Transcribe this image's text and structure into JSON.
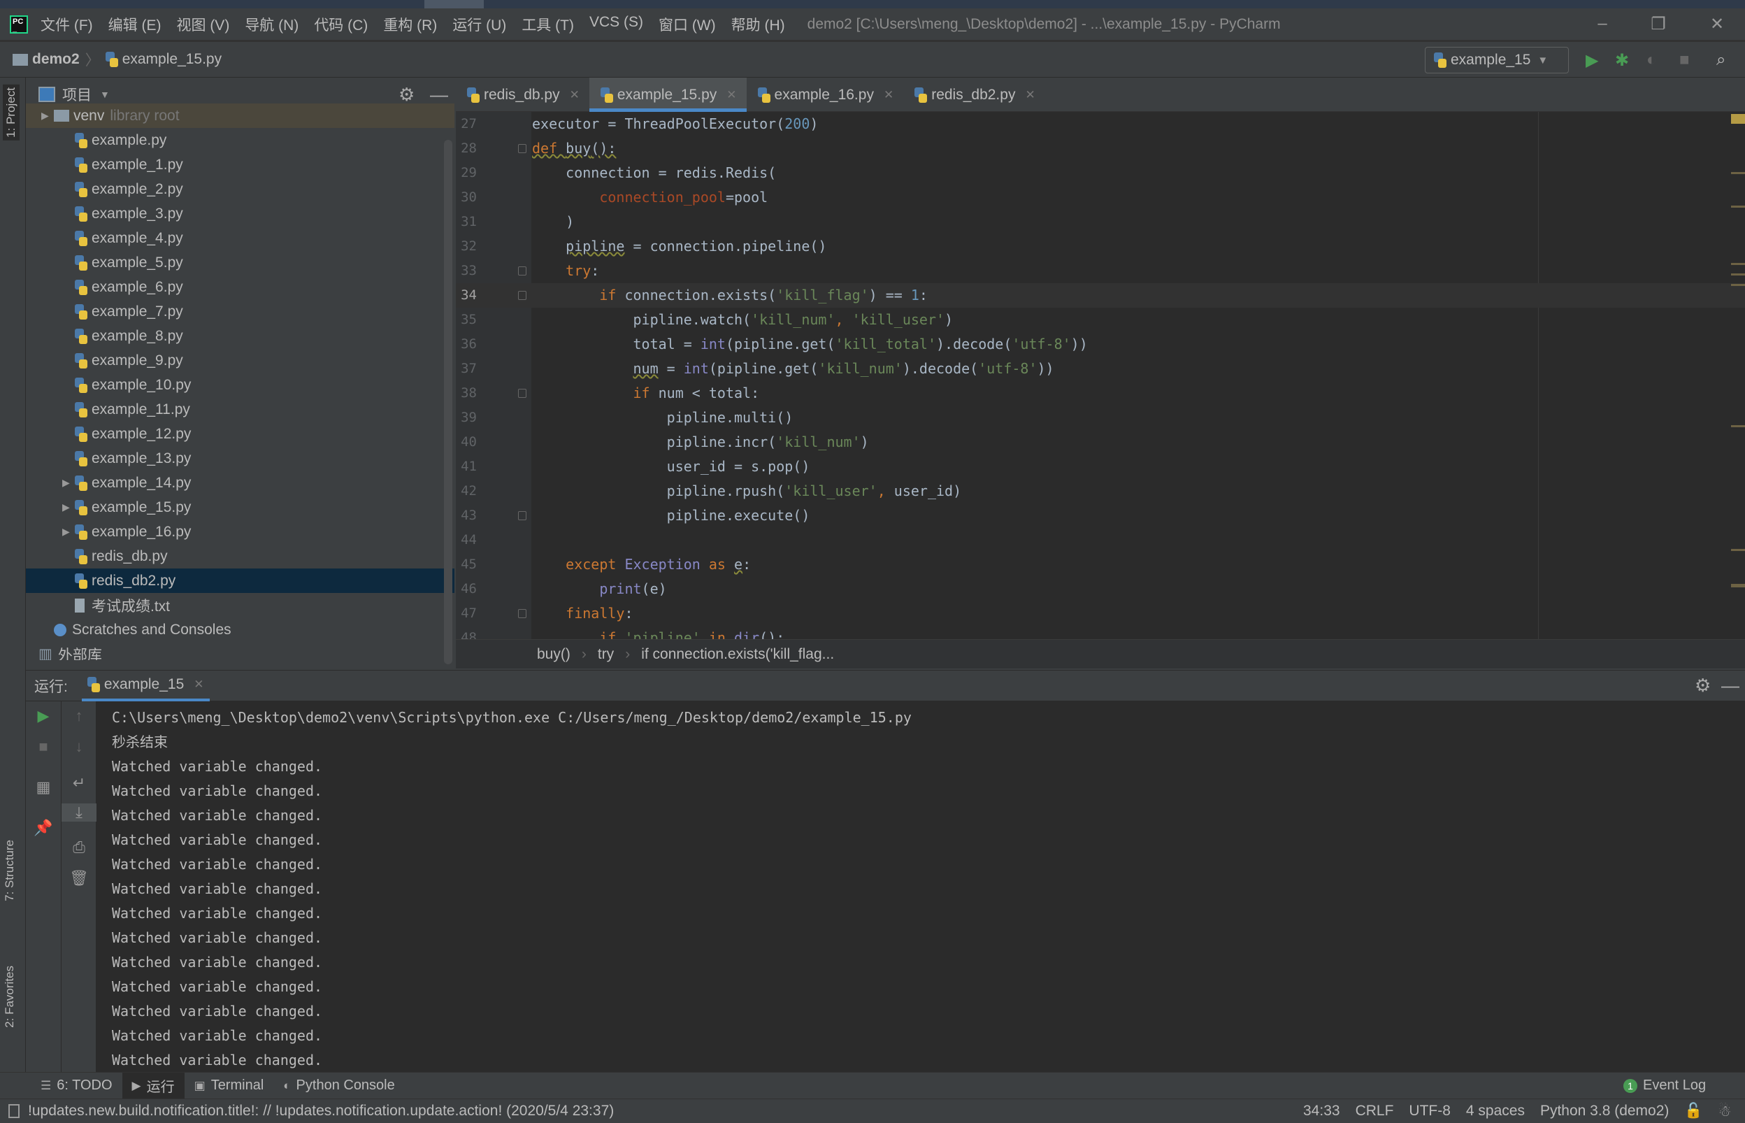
{
  "window": {
    "title": "demo2 [C:\\Users\\meng_\\Desktop\\demo2] - ...\\example_15.py - PyCharm",
    "logo": "PC"
  },
  "menu": [
    "文件 (F)",
    "编辑 (E)",
    "视图 (V)",
    "导航 (N)",
    "代码 (C)",
    "重构 (R)",
    "运行 (U)",
    "工具 (T)",
    "VCS (S)",
    "窗口 (W)",
    "帮助 (H)"
  ],
  "navbar": {
    "project": "demo2",
    "file": "example_15.py",
    "run_config": "example_15"
  },
  "left_stripe": {
    "project": "1: Project",
    "structure": "7: Structure",
    "favorites": "2: Favorites"
  },
  "project_panel": {
    "title": "项目",
    "items": [
      {
        "label": "venv",
        "hint": "library root",
        "type": "folder",
        "expandable": true,
        "depth": 1,
        "selected": false
      },
      {
        "label": "example.py",
        "type": "py",
        "depth": 2
      },
      {
        "label": "example_1.py",
        "type": "py",
        "depth": 2
      },
      {
        "label": "example_2.py",
        "type": "py",
        "depth": 2
      },
      {
        "label": "example_3.py",
        "type": "py",
        "depth": 2
      },
      {
        "label": "example_4.py",
        "type": "py",
        "depth": 2
      },
      {
        "label": "example_5.py",
        "type": "py",
        "depth": 2
      },
      {
        "label": "example_6.py",
        "type": "py",
        "depth": 2
      },
      {
        "label": "example_7.py",
        "type": "py",
        "depth": 2
      },
      {
        "label": "example_8.py",
        "type": "py",
        "depth": 2
      },
      {
        "label": "example_9.py",
        "type": "py",
        "depth": 2
      },
      {
        "label": "example_10.py",
        "type": "py",
        "depth": 2
      },
      {
        "label": "example_11.py",
        "type": "py",
        "depth": 2
      },
      {
        "label": "example_12.py",
        "type": "py",
        "depth": 2
      },
      {
        "label": "example_13.py",
        "type": "py",
        "depth": 2
      },
      {
        "label": "example_14.py",
        "type": "py",
        "depth": 2,
        "expandable": true
      },
      {
        "label": "example_15.py",
        "type": "py",
        "depth": 2,
        "expandable": true
      },
      {
        "label": "example_16.py",
        "type": "py",
        "depth": 2,
        "expandable": true
      },
      {
        "label": "redis_db.py",
        "type": "py",
        "depth": 2
      },
      {
        "label": "redis_db2.py",
        "type": "py",
        "depth": 2,
        "selected": true
      },
      {
        "label": "考试成绩.txt",
        "type": "txt",
        "depth": 2
      },
      {
        "label": "Scratches and Consoles",
        "type": "scratch",
        "depth": 1
      },
      {
        "label": "外部库",
        "type": "lib",
        "depth": 0,
        "expandable": true
      }
    ]
  },
  "tabs": [
    {
      "label": "redis_db.py",
      "active": false
    },
    {
      "label": "example_15.py",
      "active": true
    },
    {
      "label": "example_16.py",
      "active": false
    },
    {
      "label": "redis_db2.py",
      "active": false
    }
  ],
  "editor": {
    "current_line": 34,
    "lines": [
      {
        "n": 27,
        "t": [
          [
            "executor = ThreadPoolExecutor(",
            ""
          ],
          [
            "200",
            "n"
          ],
          [
            ")",
            ""
          ]
        ]
      },
      {
        "n": 28,
        "fold": true,
        "t": [
          [
            "def ",
            "k w"
          ],
          [
            "buy",
            "w"
          ],
          [
            "():",
            "w"
          ]
        ]
      },
      {
        "n": 29,
        "t": [
          [
            "    connection = redis.Redis(",
            ""
          ]
        ]
      },
      {
        "n": 30,
        "t": [
          [
            "        ",
            ""
          ],
          [
            "connection_pool",
            "p"
          ],
          [
            "=pool",
            ""
          ]
        ]
      },
      {
        "n": 31,
        "t": [
          [
            "    )",
            ""
          ]
        ]
      },
      {
        "n": 32,
        "t": [
          [
            "    ",
            ""
          ],
          [
            "pipline",
            "w"
          ],
          [
            " = connection.pipeline()",
            ""
          ]
        ]
      },
      {
        "n": 33,
        "fold": true,
        "t": [
          [
            "    ",
            ""
          ],
          [
            "try",
            "k"
          ],
          [
            ":",
            ""
          ]
        ]
      },
      {
        "n": 34,
        "fold": true,
        "t": [
          [
            "        ",
            ""
          ],
          [
            "if ",
            "k"
          ],
          [
            "connection.exists(",
            ""
          ],
          [
            "'kill_flag'",
            "s"
          ],
          [
            ") == ",
            ""
          ],
          [
            "1",
            "n"
          ],
          [
            ":",
            ""
          ]
        ]
      },
      {
        "n": 35,
        "t": [
          [
            "            pipline.watch(",
            ""
          ],
          [
            "'kill_num'",
            "s"
          ],
          [
            ", ",
            "k"
          ],
          [
            "'kill_user'",
            "s"
          ],
          [
            ")",
            ""
          ]
        ]
      },
      {
        "n": 36,
        "t": [
          [
            "            total = ",
            ""
          ],
          [
            "int",
            "b"
          ],
          [
            "(pipline.get(",
            ""
          ],
          [
            "'kill_total'",
            "s"
          ],
          [
            ").decode(",
            ""
          ],
          [
            "'utf-8'",
            "s"
          ],
          [
            "))",
            ""
          ]
        ]
      },
      {
        "n": 37,
        "t": [
          [
            "            ",
            ""
          ],
          [
            "num",
            "w"
          ],
          [
            " = ",
            ""
          ],
          [
            "int",
            "b"
          ],
          [
            "(pipline.get(",
            ""
          ],
          [
            "'kill_num'",
            "s"
          ],
          [
            ").decode(",
            ""
          ],
          [
            "'utf-8'",
            "s"
          ],
          [
            "))",
            ""
          ]
        ]
      },
      {
        "n": 38,
        "fold": true,
        "t": [
          [
            "            ",
            ""
          ],
          [
            "if ",
            "k"
          ],
          [
            "num < total:",
            ""
          ]
        ]
      },
      {
        "n": 39,
        "t": [
          [
            "                pipline.multi()",
            ""
          ]
        ]
      },
      {
        "n": 40,
        "t": [
          [
            "                pipline.incr(",
            ""
          ],
          [
            "'kill_num'",
            "s"
          ],
          [
            ")",
            ""
          ]
        ]
      },
      {
        "n": 41,
        "t": [
          [
            "                user_id = s.pop()",
            ""
          ]
        ]
      },
      {
        "n": 42,
        "t": [
          [
            "                pipline.rpush(",
            ""
          ],
          [
            "'kill_user'",
            "s"
          ],
          [
            ", ",
            "k"
          ],
          [
            "user_id)",
            ""
          ]
        ]
      },
      {
        "n": 43,
        "fold": true,
        "t": [
          [
            "                pipline.execute()",
            ""
          ]
        ]
      },
      {
        "n": 44,
        "t": []
      },
      {
        "n": 45,
        "t": [
          [
            "    ",
            ""
          ],
          [
            "except ",
            "k"
          ],
          [
            "Exception",
            "b"
          ],
          [
            " as ",
            "k"
          ],
          [
            "e",
            "w"
          ],
          [
            ":",
            ""
          ]
        ]
      },
      {
        "n": 46,
        "t": [
          [
            "        ",
            ""
          ],
          [
            "print",
            "b"
          ],
          [
            "(e)",
            ""
          ]
        ]
      },
      {
        "n": 47,
        "fold": true,
        "t": [
          [
            "    ",
            ""
          ],
          [
            "finally",
            "k"
          ],
          [
            ":",
            ""
          ]
        ]
      },
      {
        "n": 48,
        "t": [
          [
            "        ",
            ""
          ],
          [
            "if ",
            "k"
          ],
          [
            "'pipline'",
            "s"
          ],
          [
            " in ",
            "k"
          ],
          [
            "dir",
            "b"
          ],
          [
            "():",
            ""
          ]
        ]
      }
    ],
    "breadcrumbs": [
      "buy()",
      "try",
      "if connection.exists('kill_flag..."
    ]
  },
  "run_panel": {
    "label": "运行:",
    "tab": "example_15",
    "output": [
      "C:\\Users\\meng_\\Desktop\\demo2\\venv\\Scripts\\python.exe C:/Users/meng_/Desktop/demo2/example_15.py",
      "秒杀结束",
      "Watched variable changed.",
      "Watched variable changed.",
      "Watched variable changed.",
      "Watched variable changed.",
      "Watched variable changed.",
      "Watched variable changed.",
      "Watched variable changed.",
      "Watched variable changed.",
      "Watched variable changed.",
      "Watched variable changed.",
      "Watched variable changed.",
      "Watched variable changed.",
      "Watched variable changed."
    ]
  },
  "tool_windows": [
    {
      "label": "6: TODO",
      "active": false
    },
    {
      "label": "运行",
      "active": true
    },
    {
      "label": "Terminal",
      "active": false
    },
    {
      "label": "Python Console",
      "active": false
    }
  ],
  "event_log": {
    "label": "Event Log",
    "count": "1"
  },
  "status": {
    "message": "!updates.new.build.notification.title!: // !updates.notification.update.action! (2020/5/4 23:37)",
    "position": "34:33",
    "line_sep": "CRLF",
    "encoding": "UTF-8",
    "indent": "4 spaces",
    "interpreter": "Python 3.8 (demo2)"
  },
  "colors": {
    "accent": "#4a88c7",
    "selection": "#0d293e",
    "keyword": "#cc7832",
    "string": "#6a8759",
    "number": "#6897bb",
    "run_green": "#499c54"
  }
}
